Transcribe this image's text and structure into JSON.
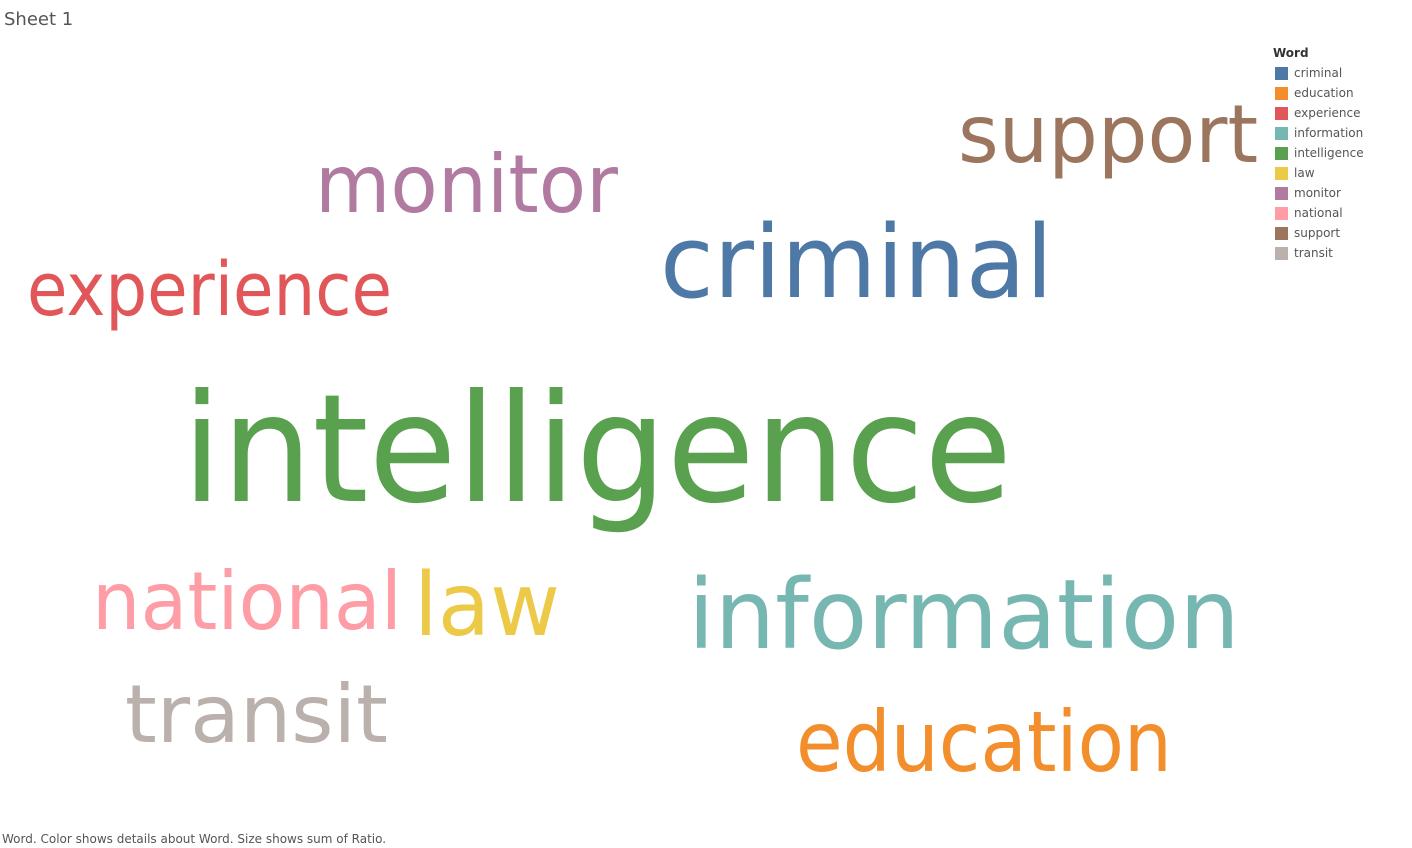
{
  "sheet": {
    "title": "Sheet 1"
  },
  "legend": {
    "title": "Word"
  },
  "caption": "Word.  Color shows details about Word.  Size shows sum of Ratio.",
  "chart_data": {
    "type": "word_cloud",
    "color_field": "Word",
    "size_field": "sum of Ratio",
    "words": [
      {
        "word": "criminal",
        "color": "#4e79a7",
        "relative_size": 0.67
      },
      {
        "word": "education",
        "color": "#f28e2b",
        "relative_size": 0.56
      },
      {
        "word": "experience",
        "color": "#e15759",
        "relative_size": 0.49
      },
      {
        "word": "information",
        "color": "#76b7b2",
        "relative_size": 0.64
      },
      {
        "word": "intelligence",
        "color": "#59a14f",
        "relative_size": 1.0
      },
      {
        "word": "law",
        "color": "#edc948",
        "relative_size": 0.58
      },
      {
        "word": "monitor",
        "color": "#b07aa1",
        "relative_size": 0.53
      },
      {
        "word": "national",
        "color": "#ff9da7",
        "relative_size": 0.53
      },
      {
        "word": "support",
        "color": "#9c755f",
        "relative_size": 0.53
      },
      {
        "word": "transit",
        "color": "#bab0ac",
        "relative_size": 0.53
      }
    ]
  }
}
